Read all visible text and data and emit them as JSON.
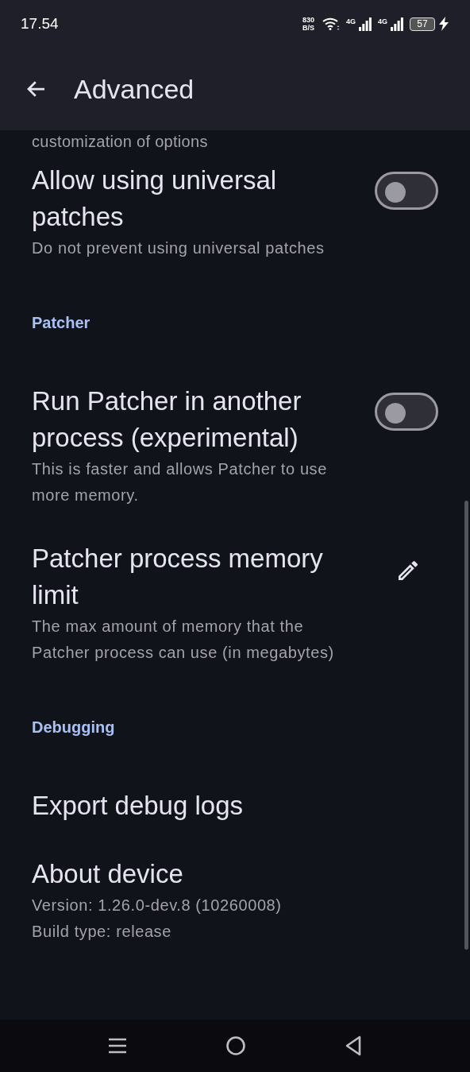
{
  "status_bar": {
    "time": "17.54",
    "net_speed": "830",
    "net_unit": "B/S",
    "sim_1": "4G",
    "sim_2": "4G",
    "battery": "57",
    "charging": true
  },
  "app_bar": {
    "title": "Advanced"
  },
  "entries": [
    {
      "kind": "text",
      "description": "customization of options"
    },
    {
      "kind": "toggle",
      "title": "Allow using universal patches",
      "description": "Do not prevent using universal patches",
      "on": false
    },
    {
      "kind": "header",
      "title": "Patcher"
    },
    {
      "kind": "toggle",
      "title": "Run Patcher in another process (experimental)",
      "description": "This is faster and allows Patcher to use more memory.",
      "on": false
    },
    {
      "kind": "edit",
      "title": "Patcher process memory limit",
      "description": "The max amount of memory that the Patcher process can use (in megabytes)"
    },
    {
      "kind": "header",
      "title": "Debugging"
    },
    {
      "kind": "plain",
      "title": "Export debug logs"
    },
    {
      "kind": "info",
      "title": "About device",
      "lines": [
        "Version: 1.26.0-dev.8 (10260008)",
        "Build type: release"
      ]
    }
  ]
}
